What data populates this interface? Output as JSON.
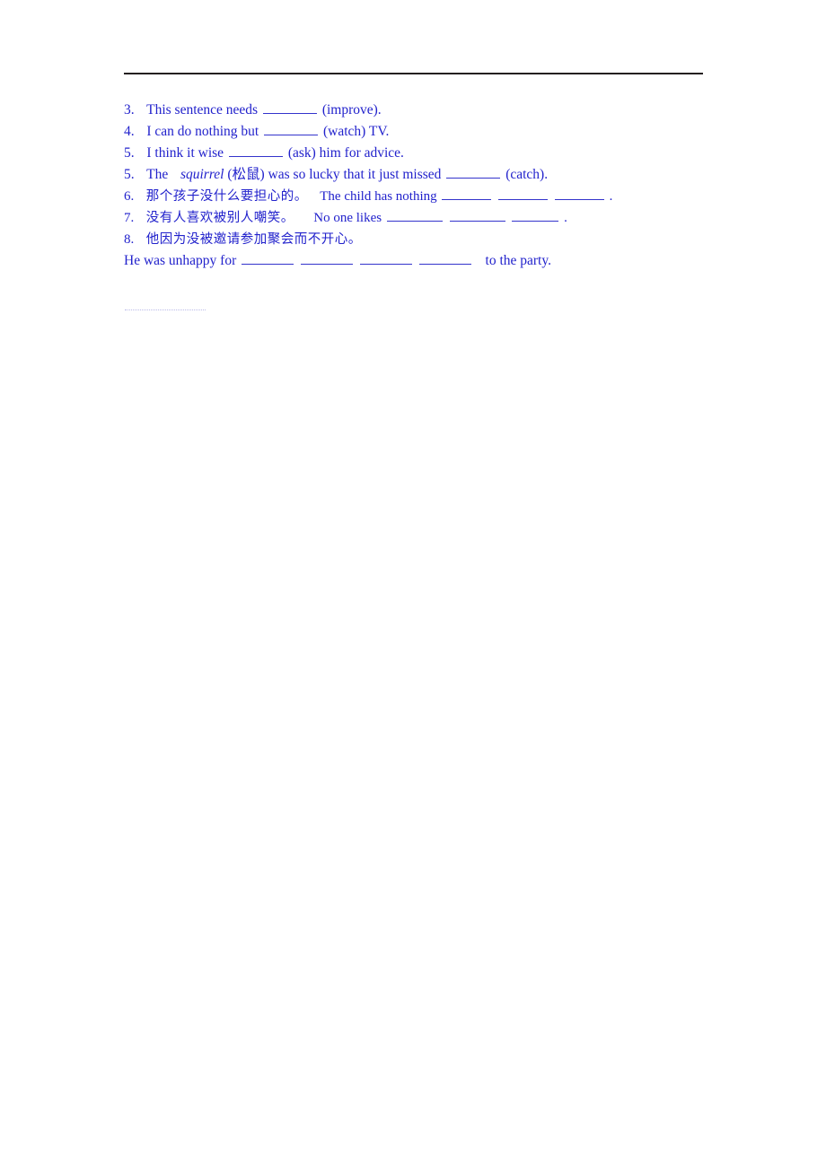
{
  "document": {
    "kind": "worksheet",
    "text_color": "#2222cc",
    "rule_color": "#231f20",
    "background": "#ffffff",
    "faint_rule_color": "#b9b9e8"
  },
  "top_rule": {
    "label": "horizontal-divider"
  },
  "exercises": [
    {
      "number": "3.",
      "language": "en",
      "parts": [
        {
          "type": "text",
          "value": "This sentence needs"
        },
        {
          "type": "blank",
          "width": "w1"
        },
        {
          "type": "text",
          "value": "(improve)."
        }
      ],
      "plain": "3. This sentence needs ________ (improve)."
    },
    {
      "number": "4.",
      "language": "en",
      "parts": [
        {
          "type": "text",
          "value": "I can do nothing but"
        },
        {
          "type": "blank",
          "width": "w1"
        },
        {
          "type": "text",
          "value": "(watch) TV."
        }
      ],
      "plain": "4. I can do nothing but ________ (watch) TV."
    },
    {
      "number": "5.",
      "language": "en",
      "parts": [
        {
          "type": "text",
          "value": "I think it wise"
        },
        {
          "type": "blank",
          "width": "w1"
        },
        {
          "type": "text",
          "value": "(ask) him for advice."
        }
      ],
      "plain": "5. I think it wise ________ (ask) him for advice."
    },
    {
      "number": "5.",
      "language": "en",
      "parts": [
        {
          "type": "text",
          "value": "The"
        },
        {
          "type": "italic",
          "value": "squirrel"
        },
        {
          "type": "text",
          "value": "(松鼠) was so lucky that it just missed"
        },
        {
          "type": "blank",
          "width": "w1"
        },
        {
          "type": "text",
          "value": "(catch)."
        }
      ],
      "plain": "5. The squirrel(松鼠) was so lucky that it just missed ________ (catch)."
    },
    {
      "number": "6.",
      "language": "mixed",
      "chinese": "那个孩子没什么要担心的。",
      "english_lead": "The child has nothing",
      "blanks": 3,
      "trailing": ".",
      "plain": "6. 那个孩子没什么要担心的。 The child has nothing _______ _______ _______."
    },
    {
      "number": "7.",
      "language": "mixed",
      "chinese": "没有人喜欢被别人嘲笑。",
      "english_lead": "No one likes",
      "blanks": 3,
      "trailing": ".",
      "plain": "7. 没有人喜欢被别人嘲笑。 No one likes _______ _______ _______."
    },
    {
      "number": "8.",
      "language": "cn",
      "chinese": "他因为没被邀请参加聚会而不开心。",
      "plain": "8. 他因为没被邀请参加聚会而不开心。"
    }
  ],
  "answer_line": {
    "lead": "He was unhappy for",
    "blanks": 4,
    "tail": "to the party.",
    "plain": "He was unhappy for ________ ________ ________ ________ to the party."
  },
  "chinese_glyphs": {
    "squirrel_gloss": "(松鼠)",
    "item6": "那个孩子没什么要担心的。",
    "item7": "没有人喜欢被别人嘲笑。",
    "item8": "他因为没被邀请参加聚会而不开心。"
  },
  "labels": {
    "improve": "(improve).",
    "watch": "(watch) TV.",
    "ask": "(ask) him for advice.",
    "catch": "(catch).",
    "squirrel": "squirrel",
    "the": "The",
    "was_so_lucky": "(松鼠) was so lucky that it just missed",
    "child_lead": "The child has nothing",
    "noone_lead": "No one likes",
    "unhappy_lead": "He was unhappy for",
    "party_tail": "to the party.",
    "period": ".",
    "n3": "3.",
    "n4": "4.",
    "n5a": "5.",
    "n5b": "5.",
    "n6": "6.",
    "n7": "7.",
    "n8": "8.",
    "s3": "This sentence needs",
    "s4": "I can do nothing but",
    "s5": "I think it wise"
  }
}
